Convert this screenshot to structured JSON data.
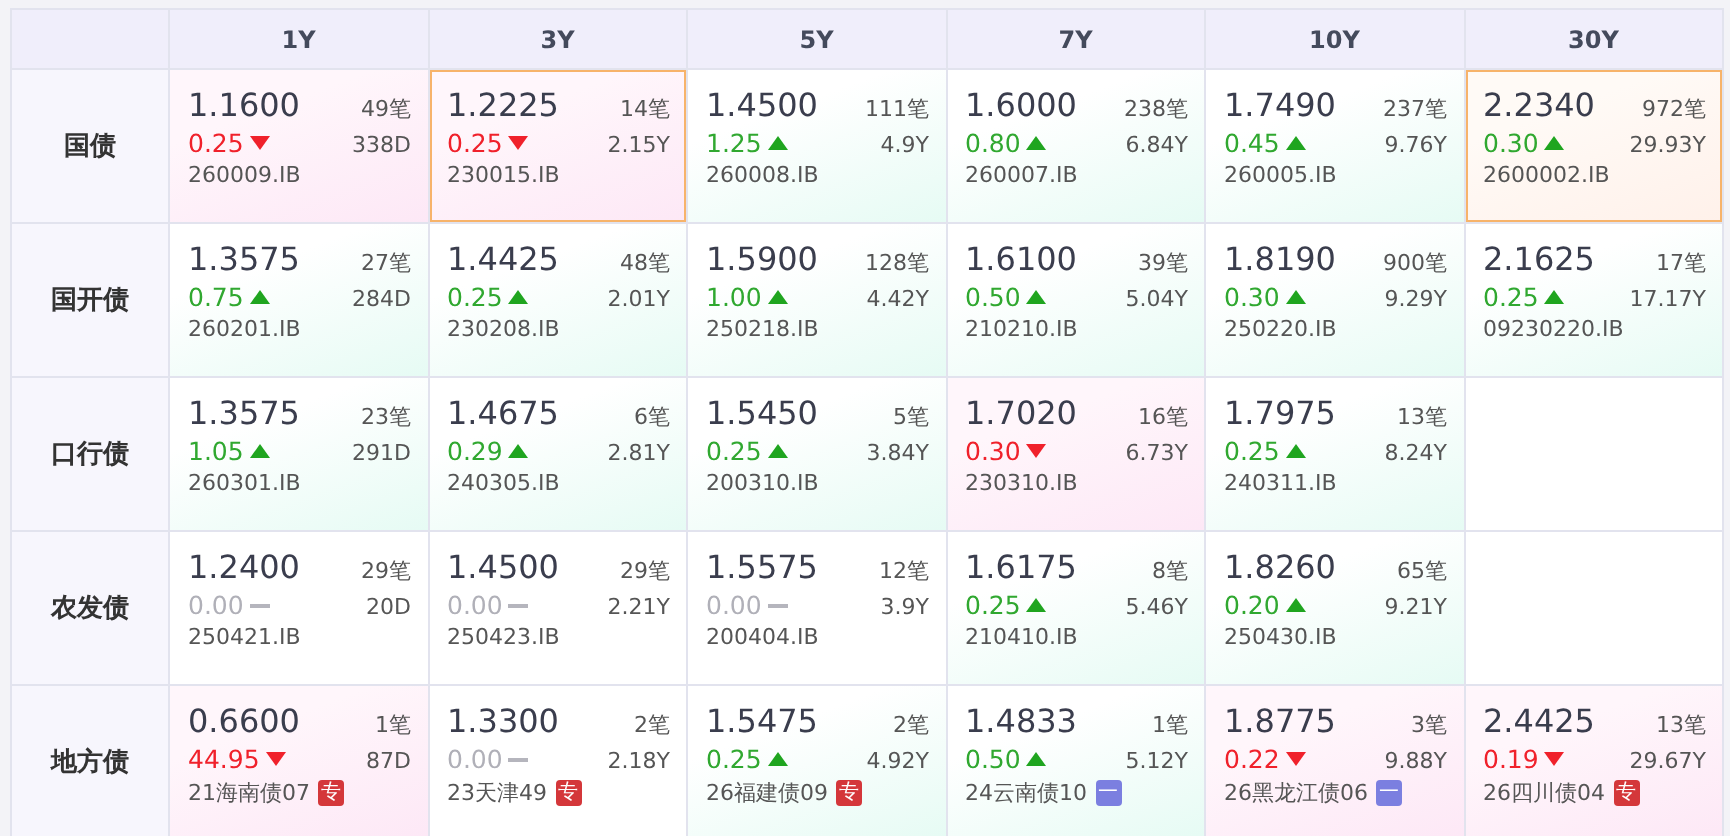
{
  "columns": [
    "1Y",
    "3Y",
    "5Y",
    "7Y",
    "10Y",
    "30Y"
  ],
  "rows": [
    {
      "label": "国债",
      "cells": [
        {
          "kind": "quote",
          "yield": "1.1600",
          "change": {
            "kind": "down",
            "text": "0.25"
          },
          "trades": "49笔",
          "term": "338D",
          "code": "260009.IB",
          "highlighted": false
        },
        {
          "kind": "quote",
          "yield": "1.2225",
          "change": {
            "kind": "down",
            "text": "0.25"
          },
          "trades": "14笔",
          "term": "2.15Y",
          "code": "230015.IB",
          "highlighted": true
        },
        {
          "kind": "quote",
          "yield": "1.4500",
          "change": {
            "kind": "up",
            "text": "1.25"
          },
          "trades": "111笔",
          "term": "4.9Y",
          "code": "260008.IB",
          "highlighted": false
        },
        {
          "kind": "quote",
          "yield": "1.6000",
          "change": {
            "kind": "up",
            "text": "0.80"
          },
          "trades": "238笔",
          "term": "6.84Y",
          "code": "260007.IB",
          "highlighted": false
        },
        {
          "kind": "quote",
          "yield": "1.7490",
          "change": {
            "kind": "up",
            "text": "0.45"
          },
          "trades": "237笔",
          "term": "9.76Y",
          "code": "260005.IB",
          "highlighted": false
        },
        {
          "kind": "quote",
          "yield": "2.2340",
          "change": {
            "kind": "up",
            "text": "0.30"
          },
          "trades": "972笔",
          "term": "29.93Y",
          "code": "2600002.IB",
          "highlighted": true
        }
      ]
    },
    {
      "label": "国开债",
      "cells": [
        {
          "kind": "quote",
          "yield": "1.3575",
          "change": {
            "kind": "up",
            "text": "0.75"
          },
          "trades": "27笔",
          "term": "284D",
          "code": "260201.IB",
          "highlighted": false
        },
        {
          "kind": "quote",
          "yield": "1.4425",
          "change": {
            "kind": "up",
            "text": "0.25"
          },
          "trades": "48笔",
          "term": "2.01Y",
          "code": "230208.IB",
          "highlighted": false
        },
        {
          "kind": "quote",
          "yield": "1.5900",
          "change": {
            "kind": "up",
            "text": "1.00"
          },
          "trades": "128笔",
          "term": "4.42Y",
          "code": "250218.IB",
          "highlighted": false
        },
        {
          "kind": "quote",
          "yield": "1.6100",
          "change": {
            "kind": "up",
            "text": "0.50"
          },
          "trades": "39笔",
          "term": "5.04Y",
          "code": "210210.IB",
          "highlighted": false
        },
        {
          "kind": "quote",
          "yield": "1.8190",
          "change": {
            "kind": "up",
            "text": "0.30"
          },
          "trades": "900笔",
          "term": "9.29Y",
          "code": "250220.IB",
          "highlighted": false
        },
        {
          "kind": "quote",
          "yield": "2.1625",
          "change": {
            "kind": "up",
            "text": "0.25"
          },
          "trades": "17笔",
          "term": "17.17Y",
          "code": "09230220.IB",
          "highlighted": false
        }
      ]
    },
    {
      "label": "口行债",
      "cells": [
        {
          "kind": "quote",
          "yield": "1.3575",
          "change": {
            "kind": "up",
            "text": "1.05"
          },
          "trades": "23笔",
          "term": "291D",
          "code": "260301.IB",
          "highlighted": false
        },
        {
          "kind": "quote",
          "yield": "1.4675",
          "change": {
            "kind": "up",
            "text": "0.29"
          },
          "trades": "6笔",
          "term": "2.81Y",
          "code": "240305.IB",
          "highlighted": false
        },
        {
          "kind": "quote",
          "yield": "1.5450",
          "change": {
            "kind": "up",
            "text": "0.25"
          },
          "trades": "5笔",
          "term": "3.84Y",
          "code": "200310.IB",
          "highlighted": false
        },
        {
          "kind": "quote",
          "yield": "1.7020",
          "change": {
            "kind": "down",
            "text": "0.30"
          },
          "trades": "16笔",
          "term": "6.73Y",
          "code": "230310.IB",
          "highlighted": false
        },
        {
          "kind": "quote",
          "yield": "1.7975",
          "change": {
            "kind": "up",
            "text": "0.25"
          },
          "trades": "13笔",
          "term": "8.24Y",
          "code": "240311.IB",
          "highlighted": false
        },
        {
          "kind": "empty"
        }
      ]
    },
    {
      "label": "农发债",
      "cells": [
        {
          "kind": "quote",
          "yield": "1.2400",
          "change": {
            "kind": "flat",
            "text": "0.00"
          },
          "trades": "29笔",
          "term": "20D",
          "code": "250421.IB",
          "highlighted": false
        },
        {
          "kind": "quote",
          "yield": "1.4500",
          "change": {
            "kind": "flat",
            "text": "0.00"
          },
          "trades": "29笔",
          "term": "2.21Y",
          "code": "250423.IB",
          "highlighted": false
        },
        {
          "kind": "quote",
          "yield": "1.5575",
          "change": {
            "kind": "flat",
            "text": "0.00"
          },
          "trades": "12笔",
          "term": "3.9Y",
          "code": "200404.IB",
          "highlighted": false
        },
        {
          "kind": "quote",
          "yield": "1.6175",
          "change": {
            "kind": "up",
            "text": "0.25"
          },
          "trades": "8笔",
          "term": "5.46Y",
          "code": "210410.IB",
          "highlighted": false
        },
        {
          "kind": "quote",
          "yield": "1.8260",
          "change": {
            "kind": "up",
            "text": "0.20"
          },
          "trades": "65笔",
          "term": "9.21Y",
          "code": "250430.IB",
          "highlighted": false
        },
        {
          "kind": "empty"
        }
      ]
    },
    {
      "label": "地方债",
      "cells": [
        {
          "kind": "quote",
          "yield": "0.6600",
          "change": {
            "kind": "down",
            "text": "44.95"
          },
          "trades": "1笔",
          "term": "87D",
          "code": "21海南债07",
          "highlighted": false,
          "tag": {
            "kind": "special",
            "text": "专"
          }
        },
        {
          "kind": "quote",
          "yield": "1.3300",
          "change": {
            "kind": "flat",
            "text": "0.00"
          },
          "trades": "2笔",
          "term": "2.18Y",
          "code": "23天津49",
          "highlighted": false,
          "tag": {
            "kind": "special",
            "text": "专"
          }
        },
        {
          "kind": "quote",
          "yield": "1.5475",
          "change": {
            "kind": "up",
            "text": "0.25"
          },
          "trades": "2笔",
          "term": "4.92Y",
          "code": "26福建债09",
          "highlighted": false,
          "tag": {
            "kind": "special",
            "text": "专"
          }
        },
        {
          "kind": "quote",
          "yield": "1.4833",
          "change": {
            "kind": "up",
            "text": "0.50"
          },
          "trades": "1笔",
          "term": "5.12Y",
          "code": "24云南债10",
          "highlighted": false,
          "tag": {
            "kind": "general",
            "text": "一"
          }
        },
        {
          "kind": "quote",
          "yield": "1.8775",
          "change": {
            "kind": "down",
            "text": "0.22"
          },
          "trades": "3笔",
          "term": "9.88Y",
          "code": "26黑龙江债06",
          "highlighted": false,
          "tag": {
            "kind": "general",
            "text": "一"
          }
        },
        {
          "kind": "quote",
          "yield": "2.4425",
          "change": {
            "kind": "down",
            "text": "0.19"
          },
          "trades": "13笔",
          "term": "29.67Y",
          "code": "26四川债04",
          "highlighted": false,
          "tag": {
            "kind": "special",
            "text": "专"
          }
        }
      ]
    }
  ]
}
